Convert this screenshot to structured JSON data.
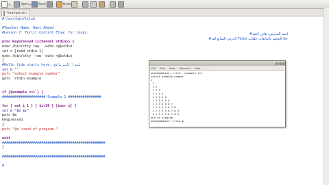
{
  "toolbar": {
    "items": [
      {
        "icon": "new-file-icon",
        "label": "",
        "arrow": "▾",
        "color": "#f6f6f2"
      },
      {
        "icon": "open-icon",
        "label": "Open",
        "arrow": "▾",
        "color": "#9aa7b6"
      },
      {
        "icon": "save-icon",
        "label": "Save",
        "arrow": "",
        "color": "#7b8fb0"
      },
      {
        "icon": "print-icon",
        "label": "",
        "arrow": "",
        "color": "#9a9a9a"
      },
      {
        "icon": "undo-icon",
        "label": "Undo",
        "arrow": "",
        "color": "#e9a13a"
      },
      {
        "icon": "redo-icon",
        "label": "",
        "arrow": "",
        "color": "#d4c9b3"
      },
      {
        "icon": "cut-icon",
        "label": "",
        "arrow": "",
        "color": "#b0b0b0"
      },
      {
        "icon": "copy-icon",
        "label": "",
        "arrow": "",
        "color": "#c9c9c9"
      },
      {
        "icon": "paste-icon",
        "label": "",
        "arrow": "",
        "color": "#c6a56a"
      },
      {
        "icon": "find-icon",
        "label": "",
        "arrow": "",
        "color": "#b8b8b8"
      },
      {
        "icon": "replace-icon",
        "label": "",
        "arrow": "",
        "color": "#a9a9a9"
      }
    ]
  },
  "tab": {
    "label": "*example.tcl",
    "close": "×"
  },
  "editor": {
    "lines": [
      {
        "t": "#!/usr/bin/tclsh",
        "c": "c-comment"
      },
      {
        "t": "",
        "c": "c-plain"
      },
      {
        "t": "#Teacher Name: Hani Ahmed",
        "c": "c-comment"
      },
      {
        "t": "#Lesson 7: Tk/tcl Control Flow: for loops.",
        "c": "c-comment"
      },
      {
        "t": "",
        "c": "c-plain"
      },
      {
        "t": "proc keypressed {{channel stdin}} {",
        "c": "c-kw"
      },
      {
        "t": "exec /bin/stty raw  -echo <@$stdin",
        "c": "c-plain"
      },
      {
        "t": "set c [read stdin 1]",
        "c": "c-plain"
      },
      {
        "t": "exec /bin/stty -raw  echo <@$stdin",
        "c": "c-plain"
      },
      {
        "t": "}",
        "c": "c-plain"
      },
      {
        "t": "#Hello tide starts here. لبدأ البرنامج",
        "c": "c-comment"
      },
      {
        "t": "set m \"\"",
        "c": "c-var"
      },
      {
        "t": "puts \"select example number\"",
        "c": "c-str"
      },
      {
        "t": "gets  stdin example",
        "c": "c-plain"
      },
      {
        "t": "",
        "c": "c-plain"
      },
      {
        "t": "",
        "c": "c-plain"
      },
      {
        "t": "if {$example ==1 } {",
        "c": "c-kw"
      },
      {
        "t": "##################### Example 1 ################",
        "c": "c-comment"
      },
      {
        "t": "",
        "c": "c-plain"
      },
      {
        "t": "for { set i 1 } { $i<30 } {incr i} {",
        "c": "c-kw"
      },
      {
        "t": "set m \"$m $i\"",
        "c": "c-var"
      },
      {
        "t": "puts $m",
        "c": "c-plain"
      },
      {
        "t": "keypressed",
        "c": "c-plain"
      },
      {
        "t": "}",
        "c": "c-plain"
      },
      {
        "t": "puts \"$m \\nend of program.\"",
        "c": "c-str"
      },
      {
        "t": "",
        "c": "c-plain"
      },
      {
        "t": "exit",
        "c": "c-kw"
      },
      {
        "t": "##################################################",
        "c": "c-comment"
      },
      {
        "t": "}",
        "c": "c-plain"
      },
      {
        "t": "",
        "c": "c-plain"
      },
      {
        "t": "##################################################",
        "c": "c-comment"
      },
      {
        "t": "",
        "c": "c-plain"
      },
      {
        "t": "#",
        "c": "c-comment"
      },
      {
        "t": "",
        "c": "c-plain"
      }
    ],
    "arabic": [
      "#اسم المدرس: هاني احمد",
      "#الدرس السابع لغة Tk/tcl التحكم بالتتابعات حلقات for"
    ]
  },
  "terminal": {
    "title": "...",
    "menus": [
      "File",
      "Edit",
      "View",
      "Terminal",
      "Help"
    ],
    "lines": [
      "ahmed@debian:~/tcl$ ./example.tcl",
      "select example number",
      "1",
      " 1",
      " 1 2",
      " 1 2 3",
      " 1 2 3 4",
      " 1 2 3 4 5",
      " 1 2 3 4 5 6",
      " 1 2 3 4 5 6 7",
      " 1 2 3 4 5 6 7 8",
      " 1 2 3 4 5 6 7 8 9",
      " 1 2 3 4 5 6 7 8 9",
      "end of program.",
      "ahmed@debian:~/tcl$ ▮"
    ]
  }
}
